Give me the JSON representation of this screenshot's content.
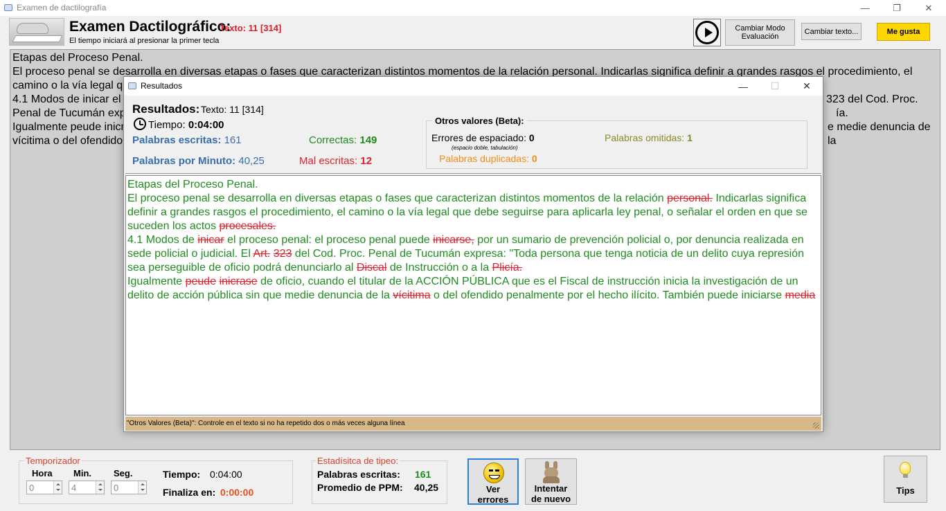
{
  "window": {
    "title": "Examen de dactilografía",
    "minimize": "—",
    "restore": "❐",
    "close": "✕"
  },
  "header": {
    "title": "Examen Dactilográfico:",
    "texto": "Texto: 11 [314]",
    "subtitle": "El tiempo iniciará al presionar la primer tecla",
    "btn_modo": "Cambiar Modo Evaluación",
    "btn_cambiar": "Cambiar texto...",
    "btn_megusta": "Me gusta"
  },
  "reference": {
    "lines": [
      "Etapas del Proceso Penal.",
      "El proceso penal se desarrolla en diversas etapas o fases que caracterizan distintos momentos de la relación personal. Indicarlas significa definir a grandes rasgos el procedimiento, el",
      "camino o la vía legal qu",
      "4.1 Modos de inicar el p",
      "Penal de Tucumán exp",
      "Igualmente peude inicr",
      "vícitima o del ofendido p"
    ],
    "right_fragments": [
      "323 del Cod. Proc.",
      "ía.",
      "e medie denuncia de la"
    ]
  },
  "dialog": {
    "title": "Resultados",
    "minimize": "—",
    "restore": "☐",
    "close": "✕",
    "heading": "Resultados:",
    "texto": "Texto: 11 [314]",
    "tiempo_label": "Tiempo:",
    "tiempo_value": "0:04:00",
    "pal_escritas_label": "Palabras escritas:",
    "pal_escritas_value": "161",
    "correctas_label": "Correctas:",
    "correctas_value": "149",
    "ppm_label": "Palabras por Minuto:",
    "ppm_value": "40,25",
    "mal_label": "Mal escritas:",
    "mal_value": "12",
    "otros_title": "Otros valores (Beta):",
    "err_esp_label": "Errores de espaciado:",
    "err_esp_value": "0",
    "err_esp_note": "(espacio doble, tabulación)",
    "omitidas_label": "Palabras omitidas:",
    "omitidas_value": "1",
    "duplicadas_label": "Palabras duplicadas:",
    "duplicadas_value": "0",
    "status": "\"Otros Valores (Beta)\": Controle en el texto si no ha repetido dos o más veces alguna línea",
    "typed": {
      "l1": "Etapas del Proceso Penal.",
      "p2a": "El proceso penal se desarrolla en diversas etapas o fases que caracterizan distintos momentos de la relación ",
      "e1": "personal.",
      "p2b": " Indicarlas significa definir a grandes rasgos el procedimiento, el camino o la vía legal que debe seguirse para aplicarla ley penal, o señalar el orden en que se suceden los actos ",
      "e2": "procesales.",
      "p3a": "4.1 Modos de ",
      "e3": "inicar",
      "p3b": " el proceso penal: el proceso penal puede ",
      "e4": "inicarse,",
      "p3c": " por un sumario de prevención policial o, por denuncia realizada en sede policial o judicial. El ",
      "e5": "Art.",
      "sp1": " ",
      "e6": "323",
      "p3d": " del Cod. Proc. Penal de Tucumán expresa: \"Toda persona que tenga noticia de un delito cuya represión sea perseguible de oficio podrá denunciarlo al ",
      "e7": "Discal",
      "p3e": " de Instrucción o a la ",
      "e8": "Plicía.",
      "p4a": "Igualmente ",
      "e9": "peude",
      "sp2": " ",
      "e10": "inicrase",
      "p4b": " de oficio, cuando el titular de la ACCIÓN PÚBLICA que es el Fiscal de instrucción inicia la investigación de un delito de acción pública sin que medie denuncia de la ",
      "e11": "vícitima",
      "p4c": " o del ofendido penalmente por el hecho ilícito. También puede iniciarse ",
      "e12": "media"
    }
  },
  "timer": {
    "group_title": "Temporizador",
    "hora_label": "Hora",
    "min_label": "Min.",
    "seg_label": "Seg.",
    "hora_value": "0",
    "min_value": "4",
    "seg_value": "0",
    "tiempo_label": "Tiempo:",
    "tiempo_value": "0:04:00",
    "finaliza_label": "Finaliza en:",
    "finaliza_value": "0:00:00"
  },
  "stats": {
    "group_title": "Estadísitca de tipeo:",
    "pal_label": "Palabras escritas:",
    "pal_value": "161",
    "ppm_label": "Promedio de PPM:",
    "ppm_value": "40,25"
  },
  "buttons": {
    "ver_l1": "Ver",
    "ver_l2": "errores",
    "intentar_l1": "Intentar",
    "intentar_l2": "de nuevo",
    "tips": "Tips"
  },
  "colors": {
    "accent_red": "#e0212b",
    "correct_green": "#1f8c1f",
    "stat_blue": "#3a6fae",
    "megusta_yellow": "#ffd700",
    "status_tan": "#d7b889"
  }
}
